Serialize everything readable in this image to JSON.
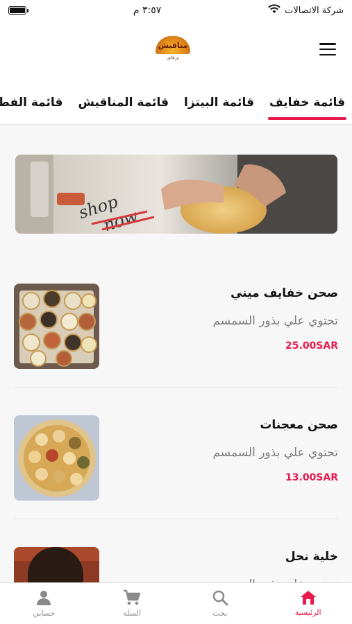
{
  "status_bar": {
    "carrier": "شركة الاتصالات",
    "time": "٣:٥٧ م",
    "wifi_icon": "wifi-icon",
    "battery_icon": "battery-icon"
  },
  "header": {
    "logo_text": "مناقيش",
    "logo_subtext": "ورقائق",
    "menu_icon": "hamburger-menu-icon"
  },
  "tabs": [
    {
      "label": "قائمة خفايف",
      "active": true
    },
    {
      "label": "قائمة البيتزا",
      "active": false
    },
    {
      "label": "قائمة المناقيش",
      "active": false
    },
    {
      "label": "قائمة الفطائر",
      "active": false
    }
  ],
  "banner": {
    "line1": "shop",
    "line2": "now"
  },
  "products": [
    {
      "name": "صحن خفايف ميني",
      "description": "تحتوي علي بذور السمسم",
      "price": "25.00SAR"
    },
    {
      "name": "صحن معجنات",
      "description": "تحتوي علي بذور السمسم",
      "price": "13.00SAR"
    },
    {
      "name": "خلية نحل",
      "description": "تحتوي علي بذور السمسم",
      "price": ""
    }
  ],
  "bottom_nav": [
    {
      "label": "الرئيسية",
      "icon": "home-icon",
      "active": true
    },
    {
      "label": "بحث",
      "icon": "search-icon",
      "active": false
    },
    {
      "label": "السلة",
      "icon": "cart-icon",
      "active": false
    },
    {
      "label": "حسابي",
      "icon": "account-icon",
      "active": false
    }
  ],
  "colors": {
    "accent": "#e8194c",
    "price": "#e8194c",
    "text_muted": "#7c7c7c"
  }
}
